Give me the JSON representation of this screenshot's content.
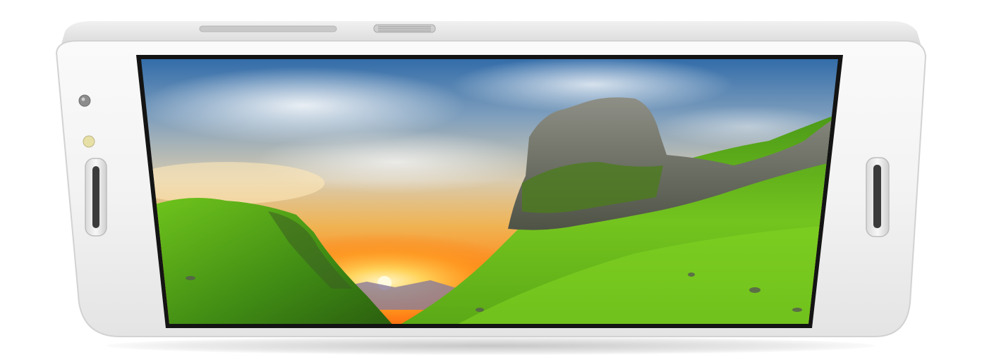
{
  "image": {
    "subject": "white-smartphone-landscape",
    "screen_content": "landscape-sunset-between-green-hills",
    "colors": {
      "body": "#f4f4f4",
      "body_edge": "#dcdcdc",
      "bezel_dark": "#1a1a1a",
      "sky_top": "#2b5f9c",
      "sky_mid": "#9fb0c0",
      "sun": "#ffb21a",
      "sunset_glow": "#ff7a1a",
      "grass_light": "#7ed21e",
      "grass_dark": "#2f6b12",
      "rock": "#6d7066"
    }
  }
}
